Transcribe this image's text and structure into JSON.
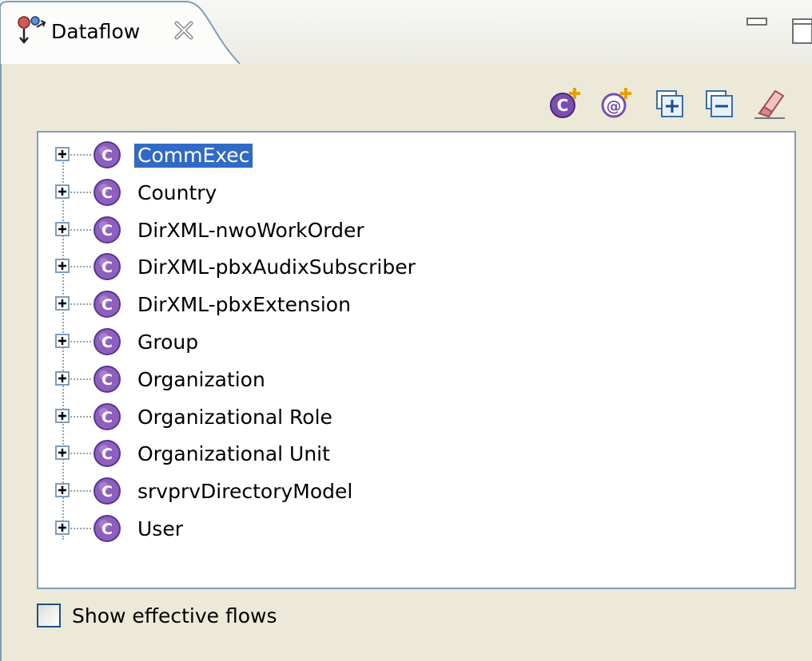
{
  "view": {
    "title": "Dataflow"
  },
  "tree": {
    "items": [
      {
        "label": "CommExec",
        "selected": true
      },
      {
        "label": "Country"
      },
      {
        "label": "DirXML-nwoWorkOrder"
      },
      {
        "label": "DirXML-pbxAudixSubscriber"
      },
      {
        "label": "DirXML-pbxExtension"
      },
      {
        "label": "Group"
      },
      {
        "label": "Organization"
      },
      {
        "label": "Organizational Role"
      },
      {
        "label": "Organizational Unit"
      },
      {
        "label": "srvprvDirectoryModel"
      },
      {
        "label": "User"
      }
    ]
  },
  "footer": {
    "checkbox_label": "Show effective flows",
    "checked": false
  },
  "colors": {
    "class_icon": "#8e5fbd",
    "selection": "#316ac5",
    "border": "#7f9db9"
  }
}
